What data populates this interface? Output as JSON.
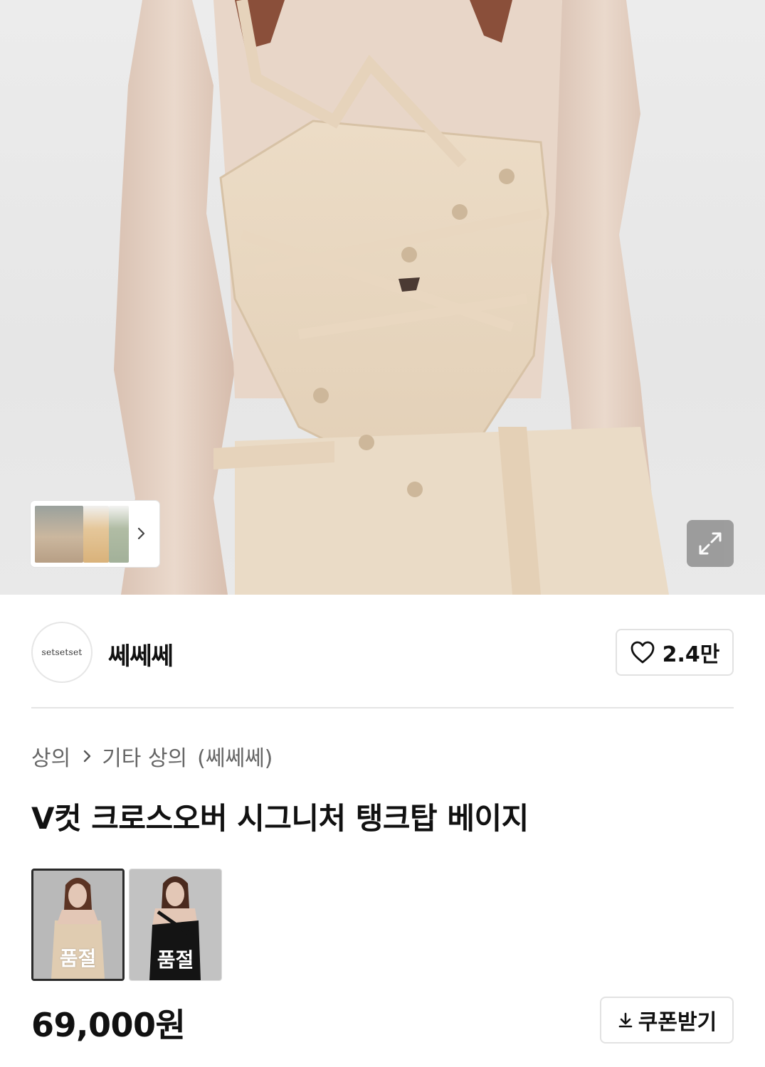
{
  "hero": {
    "image_alt": "beige crossover tank top worn by model"
  },
  "shop": {
    "logo_text": "setsetset",
    "name": "쎄쎄쎄",
    "likes": "2.4만"
  },
  "breadcrumb": {
    "category": "상의",
    "subcategory": "기타 상의",
    "brand": "(쎄쎄쎄)"
  },
  "product": {
    "title": "V컷 크로스오버 시그니처 탱크탑 베이지",
    "price": "69,000원"
  },
  "options": [
    {
      "status": "품절",
      "color": "beige",
      "selected": true
    },
    {
      "status": "품절",
      "color": "black",
      "selected": false
    }
  ],
  "coupon": {
    "label": "쿠폰받기"
  },
  "icons": {
    "expand": "expand-icon",
    "heart": "heart-icon",
    "chevron": "chevron-right-icon",
    "download": "download-icon"
  },
  "colors": {
    "border": "#e2e2e2",
    "text": "#111111",
    "muted": "#666666",
    "expand_bg": "#8f8f8f"
  }
}
